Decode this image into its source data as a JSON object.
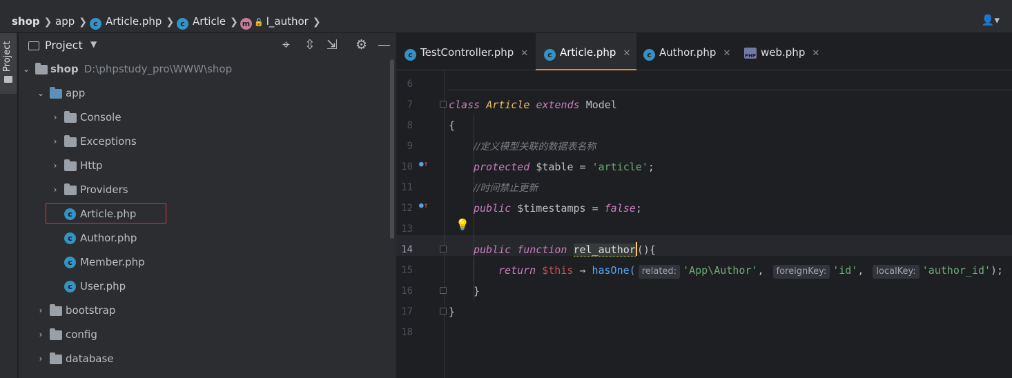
{
  "breadcrumb": {
    "items": [
      {
        "label": "shop"
      },
      {
        "label": "app"
      },
      {
        "label": "Article.php",
        "icon": "c"
      },
      {
        "label": "Article",
        "icon": "c"
      },
      {
        "label": "l_author",
        "icon": "m"
      }
    ],
    "sep": "❯",
    "user_icon": "👤▾"
  },
  "tool_strip": {
    "project_label": "Project"
  },
  "project_panel": {
    "title": "Project",
    "dropdown_icon": "▼",
    "header_icons": [
      "⌖",
      "⇳",
      "⇲",
      "⚙",
      "—"
    ],
    "tree": [
      {
        "label": "shop",
        "path": "D:\\phpstudy_pro\\WWW\\shop",
        "expanded": true,
        "type": "root"
      },
      {
        "label": "app",
        "expanded": true,
        "type": "folder-blue"
      },
      {
        "label": "Console",
        "type": "folder"
      },
      {
        "label": "Exceptions",
        "type": "folder"
      },
      {
        "label": "Http",
        "type": "folder"
      },
      {
        "label": "Providers",
        "type": "folder"
      },
      {
        "label": "Article.php",
        "type": "file",
        "icon": "c",
        "selected": true
      },
      {
        "label": "Author.php",
        "type": "file",
        "icon": "c"
      },
      {
        "label": "Member.php",
        "type": "file",
        "icon": "c"
      },
      {
        "label": "User.php",
        "type": "file",
        "icon": "c"
      },
      {
        "label": "bootstrap",
        "type": "folder"
      },
      {
        "label": "config",
        "type": "folder"
      },
      {
        "label": "database",
        "type": "folder"
      }
    ]
  },
  "tabs": [
    {
      "label": "TestController.php",
      "icon": "c",
      "close": "✕"
    },
    {
      "label": "Article.php",
      "icon": "c",
      "close": "✕",
      "active": true
    },
    {
      "label": "Author.php",
      "icon": "c",
      "close": "✕"
    },
    {
      "label": "web.php",
      "icon": "php",
      "close": "✕"
    }
  ],
  "code": {
    "line_numbers": [
      "6",
      "7",
      "8",
      "9",
      "10",
      "11",
      "12",
      "13",
      "14",
      "15",
      "16",
      "17",
      "18"
    ],
    "current_line": "14",
    "l7": {
      "kw_class": "class",
      "name": "Article",
      "kw_extends": "extends",
      "parent": "Model"
    },
    "l8": "{",
    "l9_comment": "//定义模型关联的数据表名称",
    "l10": {
      "kw": "protected",
      "var": "$table",
      "eq": " = ",
      "str": "'article'",
      "end": ";"
    },
    "l11_comment": "//时间禁止更新",
    "l12": {
      "kw": "public",
      "var": "$timestamps",
      "eq": " = ",
      "val": "false",
      "end": ";"
    },
    "l14": {
      "kw1": "public",
      "kw2": "function",
      "name": "rel_author",
      "rest": "(){"
    },
    "l15": {
      "kw": "return",
      "this": "$this",
      "arrow": " → ",
      "fn": "hasOne(",
      "hint1": "related:",
      "arg1": "'App\\Author'",
      "comma1": ", ",
      "hint2": "foreignKey:",
      "arg2": "'id'",
      "comma2": ", ",
      "hint3": "localKey:",
      "arg3": "'author_id'",
      "end": ");"
    },
    "l16": "}",
    "l17": "}"
  }
}
